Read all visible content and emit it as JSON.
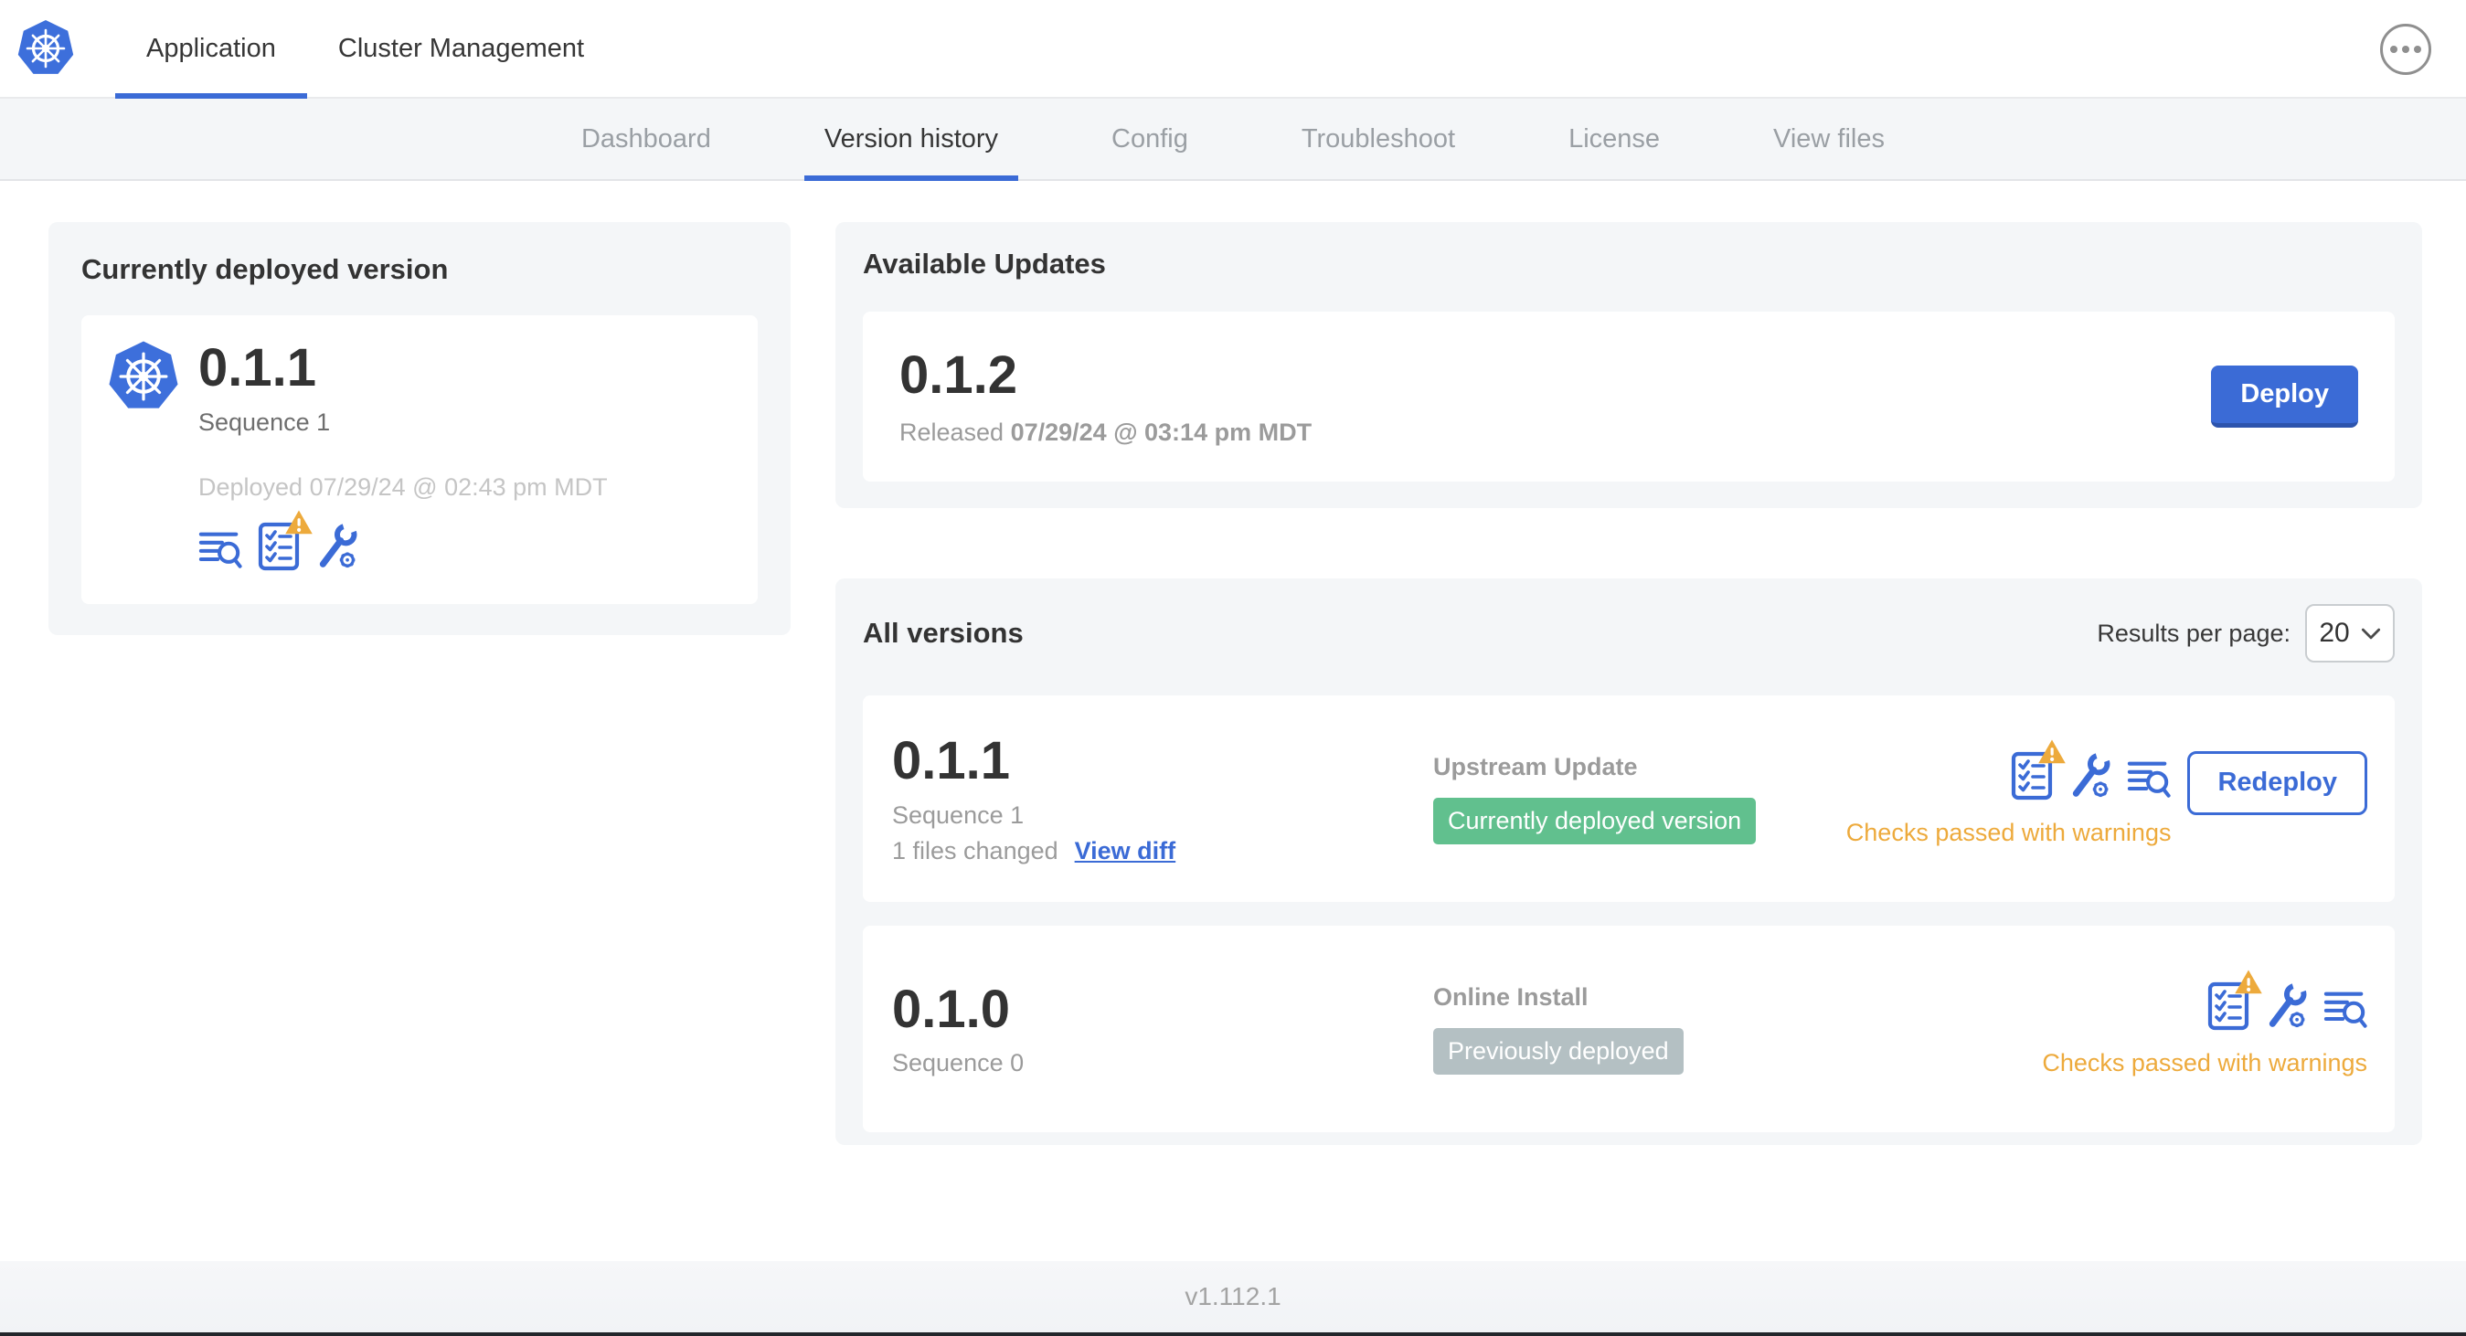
{
  "colors": {
    "accent_blue": "#3b6bd6",
    "accent_blue_dark": "#2d54ad",
    "warning_amber": "#edaa3c",
    "badge_green": "#61c08e",
    "badge_gray": "#b4c0c3",
    "panel_gray": "#f4f6f8"
  },
  "header": {
    "app_tabs": [
      {
        "label": "Application"
      },
      {
        "label": "Cluster Management"
      }
    ]
  },
  "subnav": {
    "tabs": [
      {
        "label": "Dashboard"
      },
      {
        "label": "Version history"
      },
      {
        "label": "Config"
      },
      {
        "label": "Troubleshoot"
      },
      {
        "label": "License"
      },
      {
        "label": "View files"
      }
    ]
  },
  "deployed_card": {
    "title": "Currently deployed version",
    "version": "0.1.1",
    "sequence": "Sequence 1",
    "deployed_at": "Deployed 07/29/24 @ 02:43 pm MDT",
    "icons": [
      "diff-icon",
      "preflight-checks-warning-icon",
      "edit-config-icon"
    ]
  },
  "available_updates": {
    "title": "Available Updates",
    "update": {
      "version": "0.1.2",
      "released_prefix": "Released",
      "released_date": "07/29/24 @ 03:14 pm MDT",
      "deploy_label": "Deploy"
    }
  },
  "all_versions": {
    "title": "All versions",
    "results_per_page_label": "Results per page:",
    "results_per_page_value": "20",
    "rows": [
      {
        "version": "0.1.1",
        "sequence": "Sequence 1",
        "files_changed": "1 files changed",
        "view_diff_label": "View diff",
        "source": "Upstream Update",
        "status_badge": "Currently deployed version",
        "status_badge_color": "#61c08e",
        "checks_status": "Checks passed with warnings",
        "action_label": "Redeploy",
        "icons": [
          "preflight-checks-warning-icon",
          "edit-config-icon",
          "diff-icon"
        ]
      },
      {
        "version": "0.1.0",
        "sequence": "Sequence 0",
        "source": "Online Install",
        "status_badge": "Previously deployed",
        "status_badge_color": "#b4c0c3",
        "checks_status": "Checks passed with warnings",
        "icons": [
          "preflight-checks-warning-icon",
          "edit-config-icon",
          "diff-icon"
        ]
      }
    ]
  },
  "footer": {
    "version": "v1.112.1"
  }
}
